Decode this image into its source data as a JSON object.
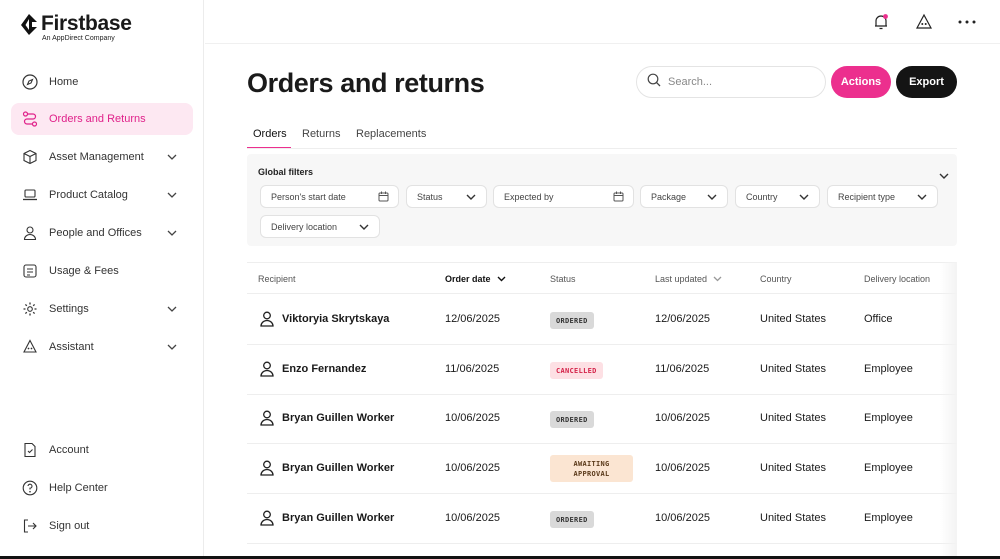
{
  "brand": {
    "name": "Firstbase",
    "subtitle": "An AppDirect Company"
  },
  "sidebar": {
    "items": [
      {
        "label": "Home",
        "icon": "compass-icon",
        "expandable": false,
        "active": false
      },
      {
        "label": "Orders and Returns",
        "icon": "route-icon",
        "expandable": false,
        "active": true
      },
      {
        "label": "Asset Management",
        "icon": "box-icon",
        "expandable": true,
        "active": false
      },
      {
        "label": "Product Catalog",
        "icon": "laptop-icon",
        "expandable": true,
        "active": false
      },
      {
        "label": "People and Offices",
        "icon": "person-icon",
        "expandable": true,
        "active": false
      },
      {
        "label": "Usage & Fees",
        "icon": "receipt-icon",
        "expandable": false,
        "active": false
      },
      {
        "label": "Settings",
        "icon": "gear-icon",
        "expandable": true,
        "active": false
      },
      {
        "label": "Assistant",
        "icon": "assistant-icon",
        "expandable": true,
        "active": false
      }
    ],
    "bottom_items": [
      {
        "label": "Account",
        "icon": "document-icon"
      },
      {
        "label": "Help Center",
        "icon": "help-icon"
      },
      {
        "label": "Sign out",
        "icon": "sign-out-icon"
      }
    ]
  },
  "header": {
    "title": "Orders and returns"
  },
  "search": {
    "placeholder": "Search..."
  },
  "buttons": {
    "actions": "Actions",
    "export": "Export"
  },
  "tabs": [
    {
      "label": "Orders",
      "active": true
    },
    {
      "label": "Returns",
      "active": false
    },
    {
      "label": "Replacements",
      "active": false
    }
  ],
  "filters": {
    "title": "Global filters",
    "chips": [
      {
        "label": "Person's start date",
        "icon": "calendar-icon"
      },
      {
        "label": "Status",
        "icon": "chevron-down-icon"
      },
      {
        "label": "Expected by",
        "icon": "calendar-icon"
      },
      {
        "label": "Package",
        "icon": "chevron-down-icon"
      },
      {
        "label": "Country",
        "icon": "chevron-down-icon"
      },
      {
        "label": "Recipient type",
        "icon": "chevron-down-icon"
      },
      {
        "label": "Delivery location",
        "icon": "chevron-down-icon"
      }
    ]
  },
  "table": {
    "columns": [
      "Recipient",
      "Order date",
      "Status",
      "Last updated",
      "Country",
      "Delivery location"
    ],
    "rows": [
      {
        "recipient": "Viktoryia Skrytskaya",
        "order_date": "12/06/2025",
        "status": "ORDERED",
        "status_kind": "ordered",
        "last_updated": "12/06/2025",
        "country": "United States",
        "delivery": "Office"
      },
      {
        "recipient": "Enzo Fernandez",
        "order_date": "11/06/2025",
        "status": "CANCELLED",
        "status_kind": "cancelled",
        "last_updated": "11/06/2025",
        "country": "United States",
        "delivery": "Employee"
      },
      {
        "recipient": "Bryan Guillen Worker",
        "order_date": "10/06/2025",
        "status": "ORDERED",
        "status_kind": "ordered",
        "last_updated": "10/06/2025",
        "country": "United States",
        "delivery": "Employee"
      },
      {
        "recipient": "Bryan Guillen Worker",
        "order_date": "10/06/2025",
        "status": "AWAITING APPROVAL",
        "status_kind": "awaiting",
        "last_updated": "10/06/2025",
        "country": "United States",
        "delivery": "Employee"
      },
      {
        "recipient": "Bryan Guillen Worker",
        "order_date": "10/06/2025",
        "status": "ORDERED",
        "status_kind": "ordered",
        "last_updated": "10/06/2025",
        "country": "United States",
        "delivery": "Employee"
      }
    ]
  },
  "colors": {
    "accent": "#ec2f8e",
    "active_bg": "#fde8f2",
    "dark": "#141414"
  }
}
